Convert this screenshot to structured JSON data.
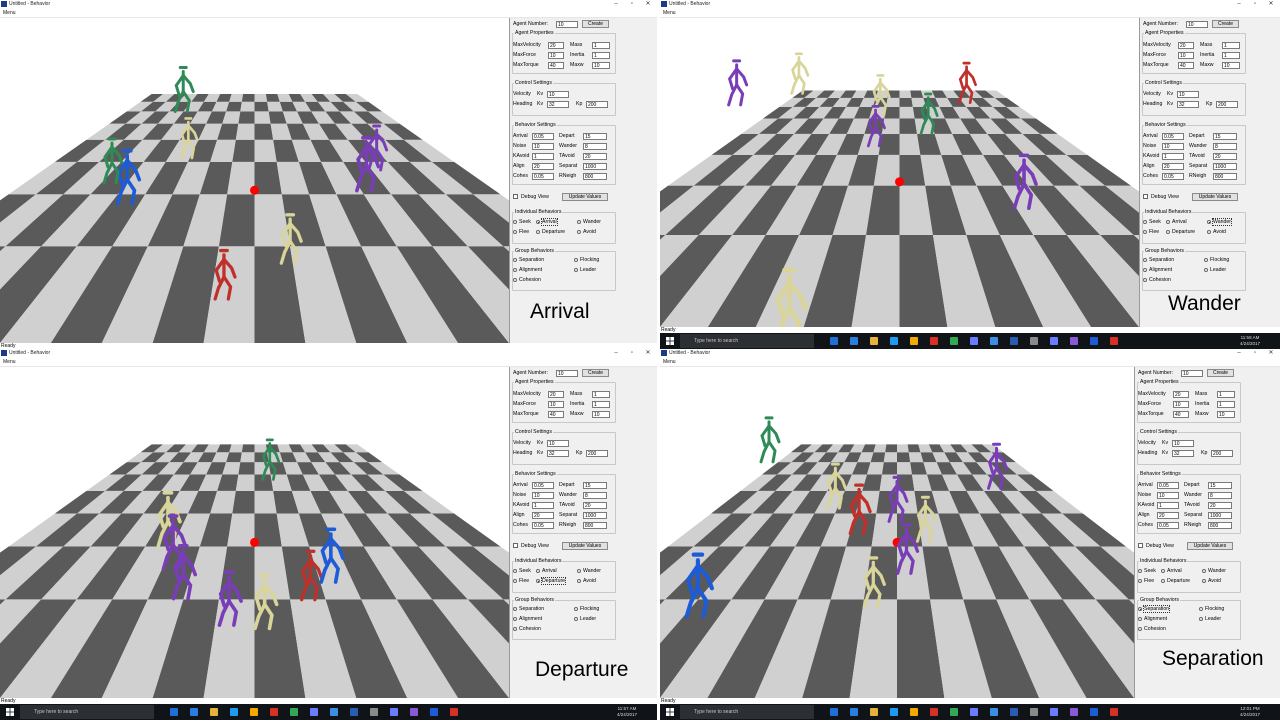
{
  "window": {
    "title": "Untitled - Behavior",
    "menu_label": "Menu",
    "status_text": "Ready",
    "captions": {
      "arrival": "Arrival",
      "wander": "Wander",
      "departure": "Departure",
      "separation": "Separation"
    }
  },
  "panel": {
    "agent_number_label": "Agent Number:",
    "agent_number_value": "10",
    "create_label": "Create",
    "agent_properties": {
      "title": "Agent Properties",
      "max_velocity_label": "MaxVelocity",
      "max_velocity_value": "20",
      "max_force_label": "MaxForce",
      "max_force_value": "10",
      "max_torque_label": "MaxTorque",
      "max_torque_value": "40",
      "mass_label": "Mass",
      "mass_value": "1",
      "inertia_label": "Inertia",
      "inertia_value": "1",
      "maxw_label": "Maxw",
      "maxw_value": "10"
    },
    "control_settings": {
      "title": "Control Settings",
      "velocity_label": "Velocity",
      "heading_label": "Heading",
      "kv_label": "Kv",
      "velocity_kv_value": "10",
      "heading_kv_value": "32",
      "kp_label": "Kp",
      "kp_value": "200"
    },
    "behavior_settings": {
      "title": "Behavior Settings",
      "arrival_label": "Arrival",
      "arrival_value": "0.05",
      "noise_label": "Noise",
      "noise_value": "10",
      "kavoid_label": "KAvoid",
      "kavoid_value": "1",
      "align_label": "Align",
      "align_value": "20",
      "cohes_label": "Cohes",
      "cohes_value": "0.05",
      "depart_label": "Depart",
      "depart_value": "15",
      "wander_label": "Wander",
      "wander_value": "8",
      "tavoid_label": "TAvoid",
      "tavoid_value": "20",
      "separat_label": "Separat",
      "separat_value": "1000",
      "rneigh_label": "RNeigh",
      "rneigh_value": "800"
    },
    "debug_view_label": "Debug View",
    "update_values_label": "Update Values",
    "individual_behaviors": {
      "title": "Individual Behaviors",
      "seek": "Seek",
      "arrival": "Arrival",
      "wander": "Wander",
      "flee": "Flee",
      "departure": "Departure",
      "avoid": "Avoid"
    },
    "group_behaviors": {
      "title": "Group Behaviors",
      "separation": "Separation",
      "flocking": "Flocking",
      "alignment": "Alignment",
      "leader": "Leader",
      "cohesion": "Cohesion"
    }
  },
  "selected_behavior": {
    "arrival": "Arrival",
    "wander": "Wander",
    "departure": "Departure",
    "separation": "Separation"
  },
  "taskbar": {
    "search_placeholder": "Type here to search",
    "time_wander": "11:58 AM",
    "time_departure": "11:57 AM",
    "time_separation": "12:01 PM",
    "date": "4/24/2017"
  },
  "scene": {
    "target_color": "#ff0000",
    "floor_light": "#d0d0d0",
    "floor_dark": "#5a5a5a",
    "agent_colors": [
      "#2e8b57",
      "#1e5bd6",
      "#7a3db8",
      "#d8d49a",
      "#c0302a"
    ]
  }
}
